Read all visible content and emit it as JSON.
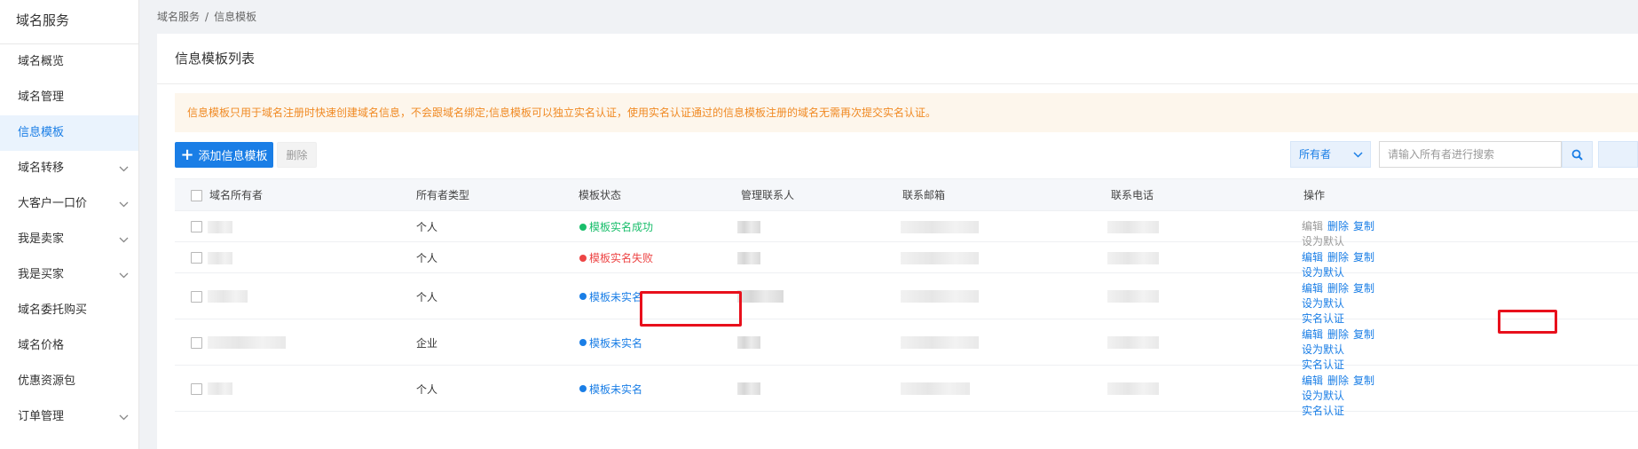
{
  "sidebar": {
    "title": "域名服务",
    "items": [
      {
        "label": "域名概览",
        "expandable": false,
        "active": false
      },
      {
        "label": "域名管理",
        "expandable": false,
        "active": false
      },
      {
        "label": "信息模板",
        "expandable": false,
        "active": true
      },
      {
        "label": "域名转移",
        "expandable": true,
        "active": false
      },
      {
        "label": "大客户一口价",
        "expandable": true,
        "active": false
      },
      {
        "label": "我是卖家",
        "expandable": true,
        "active": false
      },
      {
        "label": "我是买家",
        "expandable": true,
        "active": false
      },
      {
        "label": "域名委托购买",
        "expandable": false,
        "active": false
      },
      {
        "label": "域名价格",
        "expandable": false,
        "active": false
      },
      {
        "label": "优惠资源包",
        "expandable": false,
        "active": false
      },
      {
        "label": "订单管理",
        "expandable": true,
        "active": false
      }
    ]
  },
  "breadcrumb": {
    "root": "域名服务",
    "separator": "/",
    "current": "信息模板"
  },
  "panel": {
    "title": "信息模板列表"
  },
  "notice": {
    "text": "信息模板只用于域名注册时快速创建域名信息，不会跟域名绑定;信息模板可以独立实名认证，使用实名认证通过的信息模板注册的域名无需再次提交实名认证。",
    "color": "#f08a24",
    "background": "#fdf6ec"
  },
  "toolbar": {
    "add_label": "添加信息模板",
    "delete_label": "删除",
    "owner_filter": "所有者",
    "search_placeholder": "请输入所有者进行搜索"
  },
  "table": {
    "headers": {
      "owner": "域名所有者",
      "owner_type": "所有者类型",
      "status": "模板状态",
      "admin": "管理联系人",
      "email": "联系邮箱",
      "phone": "联系电话",
      "actions": "操作"
    },
    "ops": {
      "edit": "编辑",
      "delete": "删除",
      "copy": "复制",
      "set_default": "设为默认",
      "verify": "实名认证"
    },
    "rows": [
      {
        "owner_type": "个人",
        "status": "模板实名成功",
        "status_color": "#19be6b",
        "edit_disabled": true,
        "default_disabled": true,
        "has_verify": false
      },
      {
        "owner_type": "个人",
        "status": "模板实名失败",
        "status_color": "#ed4545",
        "edit_disabled": false,
        "default_disabled": false,
        "has_verify": false
      },
      {
        "owner_type": "个人",
        "status": "模板未实名",
        "status_color": "#1a7ee6",
        "edit_disabled": false,
        "default_disabled": false,
        "has_verify": true
      },
      {
        "owner_type": "企业",
        "status": "模板未实名",
        "status_color": "#1a7ee6",
        "edit_disabled": false,
        "default_disabled": false,
        "has_verify": true
      },
      {
        "owner_type": "个人",
        "status": "模板未实名",
        "status_color": "#1a7ee6",
        "edit_disabled": false,
        "default_disabled": false,
        "has_verify": true
      }
    ]
  },
  "colors": {
    "accent": "#1a7ee6",
    "highlight": "#e8101c"
  }
}
